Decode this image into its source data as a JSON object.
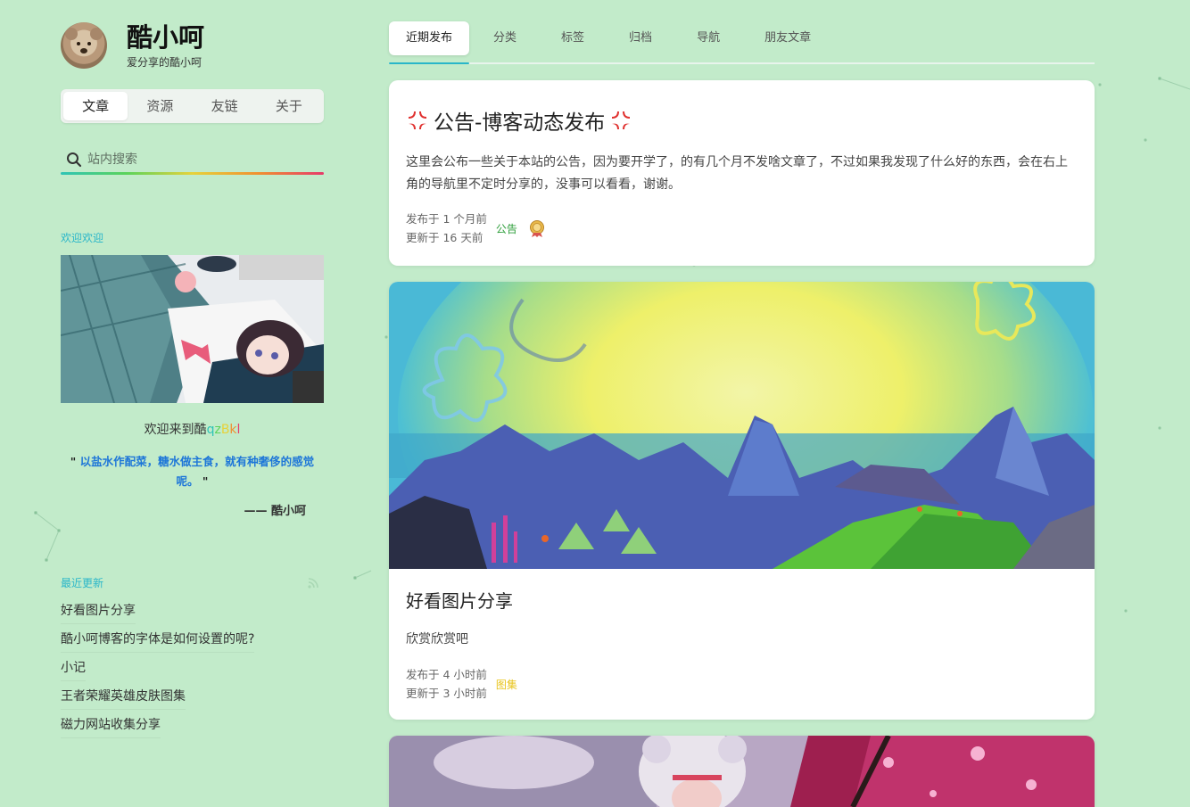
{
  "site": {
    "name": "酷小呵",
    "description": "爱分享的酷小呵"
  },
  "sidebar": {
    "nav": [
      {
        "label": "文章",
        "active": true
      },
      {
        "label": "资源",
        "active": false
      },
      {
        "label": "友链",
        "active": false
      },
      {
        "label": "关于",
        "active": false
      }
    ],
    "search": {
      "placeholder": "站内搜索"
    },
    "welcome": {
      "section_title": "欢迎欢迎",
      "greeting_prefix": "欢迎来到酷",
      "greeting_rainbow": [
        "q",
        "z",
        "B",
        "k",
        "l"
      ],
      "quote": "以盐水作配菜，糖水做主食，就有种奢侈的感觉呢。",
      "quote_author": "—— 酷小呵"
    },
    "recent": {
      "section_title": "最近更新",
      "items": [
        "好看图片分享",
        "酷小呵博客的字体是如何设置的呢?",
        "小记",
        "王者荣耀英雄皮肤图集",
        "磁力网站收集分享"
      ]
    }
  },
  "tabs": [
    {
      "label": "近期发布",
      "active": true
    },
    {
      "label": "分类",
      "active": false
    },
    {
      "label": "标签",
      "active": false
    },
    {
      "label": "归档",
      "active": false
    },
    {
      "label": "导航",
      "active": false
    },
    {
      "label": "朋友文章",
      "active": false
    }
  ],
  "posts": [
    {
      "title": "公告-博客动态发布",
      "excerpt": "这里会公布一些关于本站的公告，因为要开学了，的有几个月不发啥文章了，不过如果我发现了什么好的东西，会在右上角的导航里不定时分享的，没事可以看看，谢谢。",
      "published": "发布于 1 个月前",
      "updated": "更新于 16 天前",
      "category": "公告",
      "category_color": "#2e9e3a"
    },
    {
      "title": "好看图片分享",
      "excerpt": "欣赏欣赏吧",
      "published": "发布于 4 小时前",
      "updated": "更新于 3 小时前",
      "category": "图集",
      "category_color": "#e8c41c"
    }
  ],
  "colors": {
    "background": "#c2ebca",
    "accent": "#29b6c9",
    "quote": "#1d76d8",
    "rainbow": [
      "#2ec4b6",
      "#5ad35a",
      "#e6d23a",
      "#f09030",
      "#e63a6a"
    ]
  }
}
